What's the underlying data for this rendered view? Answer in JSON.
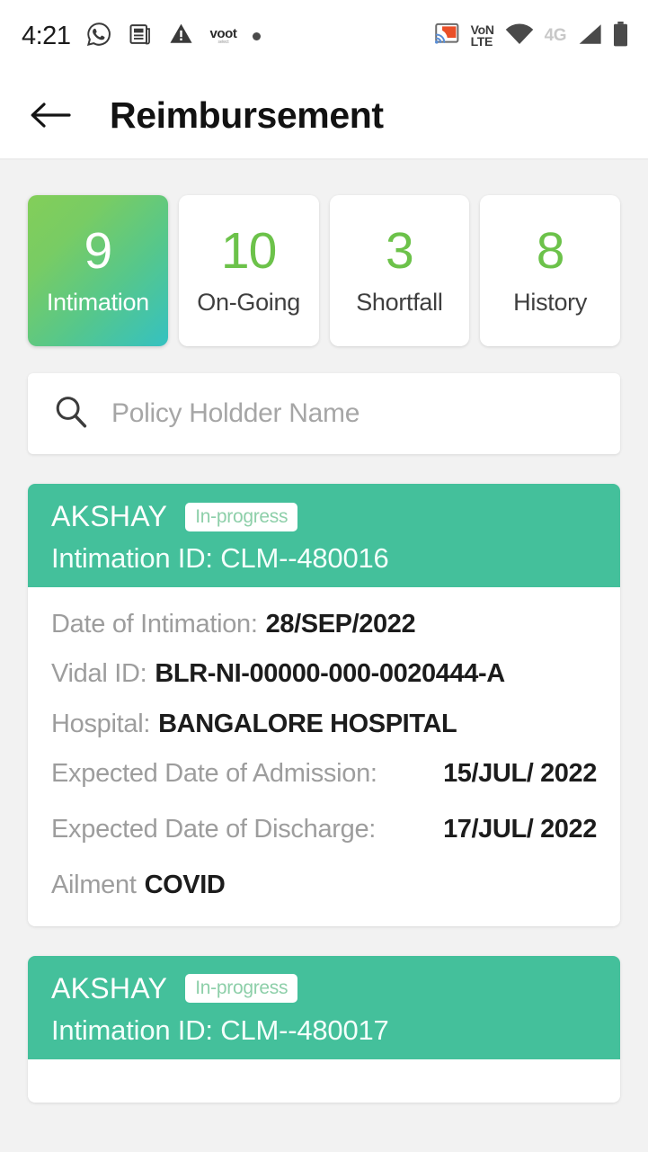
{
  "status_bar": {
    "time": "4:21",
    "left_icons": [
      {
        "name": "whatsapp-icon"
      },
      {
        "name": "news-article-icon"
      },
      {
        "name": "warning-triangle-icon"
      },
      {
        "name": "voot-app-icon",
        "top": "voot",
        "bottom": "select"
      },
      {
        "name": "dot-notification-icon"
      }
    ],
    "right_icons": [
      {
        "name": "screen-cast-icon"
      },
      {
        "name": "volte-icon",
        "top": "VoN",
        "bottom": "LTE"
      },
      {
        "name": "wifi-icon"
      },
      {
        "name": "network-4g-label",
        "text": "4G"
      },
      {
        "name": "cellular-signal-icon"
      },
      {
        "name": "battery-icon"
      }
    ]
  },
  "app_bar": {
    "back_label": "back",
    "title": "Reimbursement"
  },
  "tiles": [
    {
      "count": "9",
      "label": "Intimation",
      "active": true
    },
    {
      "count": "10",
      "label": "On-Going",
      "active": false
    },
    {
      "count": "3",
      "label": "Shortfall",
      "active": false
    },
    {
      "count": "8",
      "label": "History",
      "active": false
    }
  ],
  "search": {
    "placeholder": "Policy Holdder Name",
    "value": ""
  },
  "cards": [
    {
      "holder_name": "AKSHAY",
      "status": "In-progress",
      "intimation_id": "Intimation ID: CLM--480016",
      "fields": [
        {
          "label": "Date of Intimation:",
          "value": "28/SEP/2022"
        },
        {
          "label": "Vidal ID:",
          "value": "BLR-NI-00000-000-0020444-A"
        },
        {
          "label": "Hospital:",
          "value": "BANGALORE HOSPITAL"
        },
        {
          "label": "Expected Date of Admission:",
          "value": "15/JUL/ 2022"
        },
        {
          "label": "Expected Date of Discharge:",
          "value": "17/JUL/ 2022"
        },
        {
          "label": "Ailment",
          "value": "COVID"
        }
      ]
    },
    {
      "holder_name": "AKSHAY",
      "status": "In-progress",
      "intimation_id": "Intimation ID: CLM--480017"
    }
  ],
  "colors": {
    "brand_green": "#44c09b",
    "accent_green": "#6cc24a",
    "gradient_start": "#83ce59",
    "gradient_end": "#35c1c1",
    "page_background": "#f2f2f2",
    "cast_icon": "#ea4f28"
  }
}
